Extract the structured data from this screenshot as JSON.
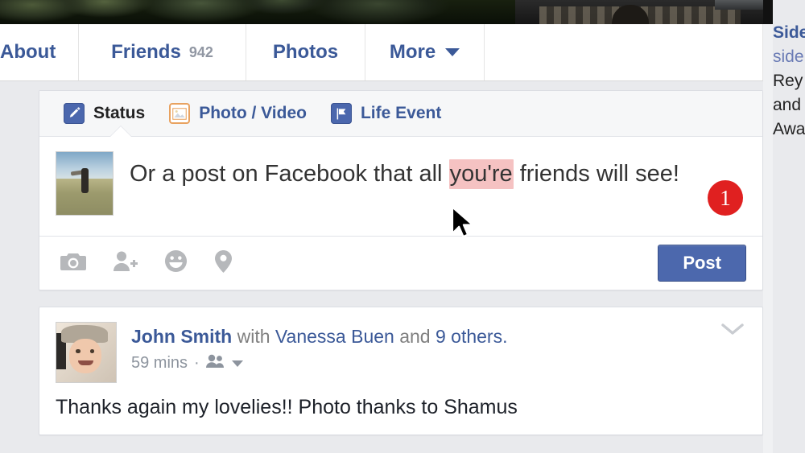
{
  "profile_nav": {
    "tabs": [
      {
        "label": "About",
        "count": "",
        "has_caret": false
      },
      {
        "label": "Friends",
        "count": "942",
        "has_caret": false
      },
      {
        "label": "Photos",
        "count": "",
        "has_caret": false
      },
      {
        "label": "More",
        "count": "",
        "has_caret": true
      }
    ]
  },
  "composer": {
    "tabs": [
      {
        "label": "Status",
        "icon": "pencil-icon",
        "active": true
      },
      {
        "label": "Photo / Video",
        "icon": "photo-icon",
        "active": false
      },
      {
        "label": "Life Event",
        "icon": "flag-icon",
        "active": false
      }
    ],
    "status_text_before": "Or a post on Facebook that all ",
    "status_text_highlighted": "you're",
    "status_text_after": " friends will see!",
    "highlight_color": "#f5c2c2",
    "badge_count": "1",
    "badge_color": "#e02020",
    "actions": [
      {
        "icon": "camera-icon"
      },
      {
        "icon": "tag-person-icon"
      },
      {
        "icon": "emoji-icon"
      },
      {
        "icon": "location-pin-icon"
      }
    ],
    "post_button_label": "Post",
    "post_button_color": "#4c68ad"
  },
  "post": {
    "author": "John Smith",
    "with_word": "with",
    "tagged": "Vanessa Buen",
    "and_word": "and",
    "others": "9 others.",
    "timestamp": "59 mins",
    "separator": "·",
    "audience_icon": "friends-icon",
    "body": "Thanks again my lovelies!! Photo thanks to Shamus",
    "menu_icon": "chevron-down-icon"
  },
  "sidebar": {
    "lines": [
      {
        "text": "Side",
        "style": "title"
      },
      {
        "text": "side",
        "style": "sub"
      },
      {
        "text": "Rey",
        "style": "text"
      },
      {
        "text": "and",
        "style": "text"
      },
      {
        "text": "Awa",
        "style": "text"
      }
    ]
  },
  "colors": {
    "facebook_blue": "#3b5998",
    "page_background": "#e9eaed"
  }
}
